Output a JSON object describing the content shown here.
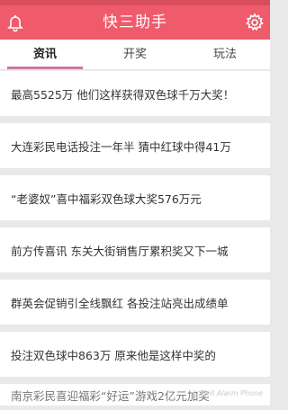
{
  "header": {
    "title": "快三助手",
    "left_icon": "bell-icon",
    "right_icon": "gear-icon",
    "color": "#ef5b6b"
  },
  "tabs": [
    {
      "label": "资讯",
      "active": true
    },
    {
      "label": "开奖",
      "active": false
    },
    {
      "label": "玩法",
      "active": false
    }
  ],
  "news": [
    "最高5525万 他们这样获得双色球千万大奖！",
    "大连彩民电话投注一年半 猜中红球中得41万",
    "“老婆奴”喜中福彩双色球大奖576万元",
    "前方传喜讯 东关大街销售厅累积奖又下一城",
    "群英会促销引全线飘红 各投注站亮出成绩单",
    "投注双色球中863万 原来他是这样中奖的",
    "南京彩民喜迎福彩“好运”游戏2亿元加奖"
  ],
  "watermark": "© Bell Alarm Phone"
}
